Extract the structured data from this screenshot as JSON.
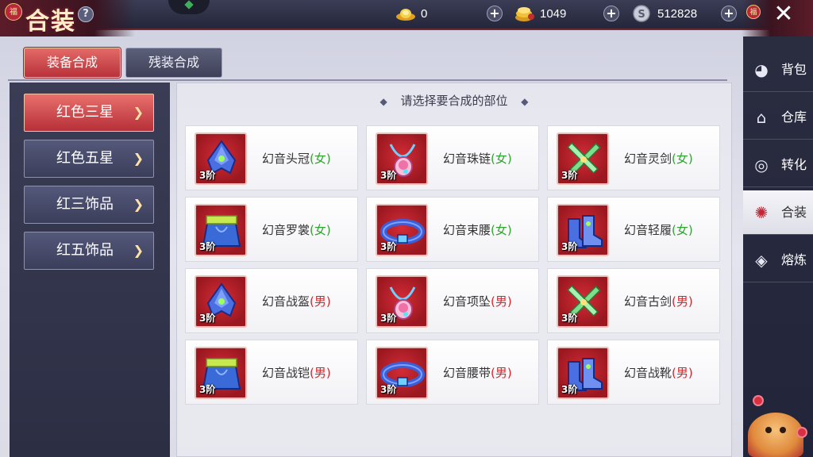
{
  "header": {
    "title": "合装",
    "help": "?",
    "title_badge": "福",
    "close_badge": "福",
    "close": "✕"
  },
  "currencies": [
    {
      "icon": "gold-ingot-icon",
      "value": "0"
    },
    {
      "icon": "gold-coin-stack-icon",
      "value": "1049"
    },
    {
      "icon": "silver-coin-icon",
      "value": "512828"
    }
  ],
  "tabs": [
    {
      "label": "装备合成",
      "active": true
    },
    {
      "label": "残装合成",
      "active": false
    }
  ],
  "categories": [
    {
      "label": "红色三星",
      "active": true
    },
    {
      "label": "红色五星",
      "active": false
    },
    {
      "label": "红三饰品",
      "active": false
    },
    {
      "label": "红五饰品",
      "active": false
    }
  ],
  "prompt": "请选择要合成的部位",
  "items": [
    {
      "name": "幻音头冠",
      "gender": "(女)",
      "tier": "3阶",
      "icon": "helmet-icon"
    },
    {
      "name": "幻音珠链",
      "gender": "(女)",
      "tier": "3阶",
      "icon": "necklace-icon"
    },
    {
      "name": "幻音灵剑",
      "gender": "(女)",
      "tier": "3阶",
      "icon": "crossed-swords-icon"
    },
    {
      "name": "幻音罗裳",
      "gender": "(女)",
      "tier": "3阶",
      "icon": "robe-icon"
    },
    {
      "name": "幻音束腰",
      "gender": "(女)",
      "tier": "3阶",
      "icon": "belt-icon"
    },
    {
      "name": "幻音轻履",
      "gender": "(女)",
      "tier": "3阶",
      "icon": "boots-icon"
    },
    {
      "name": "幻音战盔",
      "gender": "(男)",
      "tier": "3阶",
      "icon": "helmet-icon"
    },
    {
      "name": "幻音项坠",
      "gender": "(男)",
      "tier": "3阶",
      "icon": "necklace-icon"
    },
    {
      "name": "幻音古剑",
      "gender": "(男)",
      "tier": "3阶",
      "icon": "crossed-swords-icon"
    },
    {
      "name": "幻音战铠",
      "gender": "(男)",
      "tier": "3阶",
      "icon": "robe-icon"
    },
    {
      "name": "幻音腰带",
      "gender": "(男)",
      "tier": "3阶",
      "icon": "belt-icon"
    },
    {
      "name": "幻音战靴",
      "gender": "(男)",
      "tier": "3阶",
      "icon": "boots-icon"
    }
  ],
  "nav": [
    {
      "label": "背包",
      "icon": "bag-icon",
      "active": false
    },
    {
      "label": "仓库",
      "icon": "warehouse-icon",
      "active": false
    },
    {
      "label": "转化",
      "icon": "swirl-icon",
      "active": false
    },
    {
      "label": "合装",
      "icon": "combine-icon",
      "active": true
    },
    {
      "label": "熔炼",
      "icon": "smelt-icon",
      "active": false
    }
  ],
  "colors": {
    "accent_red": "#b8323a",
    "female_green": "#2fa32f",
    "male_red": "#d2262c",
    "panel_dark": "#2c2e44"
  }
}
